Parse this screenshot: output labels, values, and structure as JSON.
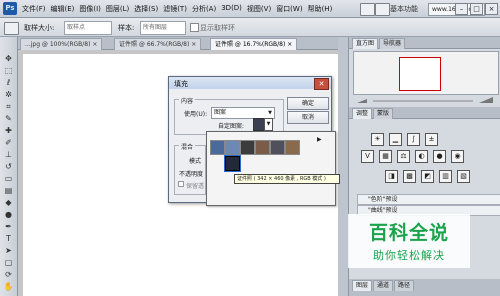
{
  "app": {
    "logo": "Ps"
  },
  "menubar": {
    "items": [
      "文件(F)",
      "编辑(E)",
      "图像(I)",
      "图层(L)",
      "选择(S)",
      "滤镜(T)",
      "分析(A)",
      "3D(D)",
      "视图(V)",
      "窗口(W)",
      "帮助(H)"
    ],
    "workspace": "基本功能",
    "site_watermark": "www.16xx8.com",
    "window_buttons": [
      "–",
      "□",
      "×"
    ]
  },
  "options_bar": {
    "sample_size_label": "取样大小:",
    "sample_size_value": "取样点",
    "sample_label": "样本:",
    "sample_value": "所有图层",
    "show_ring_label": "显示取样环"
  },
  "tabs": [
    {
      "label": "...jpg @ 100%(RGB/8) ×",
      "active": false
    },
    {
      "label": "证件照 @ 66.7%(RGB/8) ×",
      "active": false
    },
    {
      "label": "证件照 @ 16.7%(RGB/8) ×",
      "active": true
    }
  ],
  "right_panel": {
    "top_tabs": [
      "直方图",
      "导航器"
    ],
    "adjust_tabs": [
      "调整",
      "蒙版"
    ],
    "presets": [
      "\"色阶\"预设",
      "\"曲线\"预设"
    ],
    "bottom_tabs": [
      "图层",
      "通道",
      "路径"
    ]
  },
  "fill_dialog": {
    "title": "填充",
    "contents_group": "内容",
    "use_label": "使用(U):",
    "use_value": "图案",
    "custom_pattern_label": "自定图案:",
    "blending_group": "混合",
    "mode_label": "模式",
    "opacity_label": "不透明度",
    "preserve_label": "保留透",
    "ok_button": "确定",
    "cancel_button": "取消"
  },
  "pattern_picker": {
    "arrow": "▶",
    "tooltip": "证件照 ( 342 × 460 像素 , RGB 模式 )",
    "patterns": [
      {
        "name": "pattern-1",
        "color": "#4a6a9c"
      },
      {
        "name": "pattern-2",
        "color": "#6c88b4"
      },
      {
        "name": "pattern-3",
        "color": "#3c3c3c"
      },
      {
        "name": "pattern-4",
        "color": "#7a5c48"
      },
      {
        "name": "pattern-5",
        "color": "#50505a"
      },
      {
        "name": "pattern-6",
        "color": "#8a6a4a"
      },
      {
        "name": "pattern-7-selected",
        "color": "#222a3a"
      }
    ]
  },
  "watermark": {
    "line1": "百科全说",
    "line2": "助你轻松解决",
    "color": "#1aa34a"
  }
}
